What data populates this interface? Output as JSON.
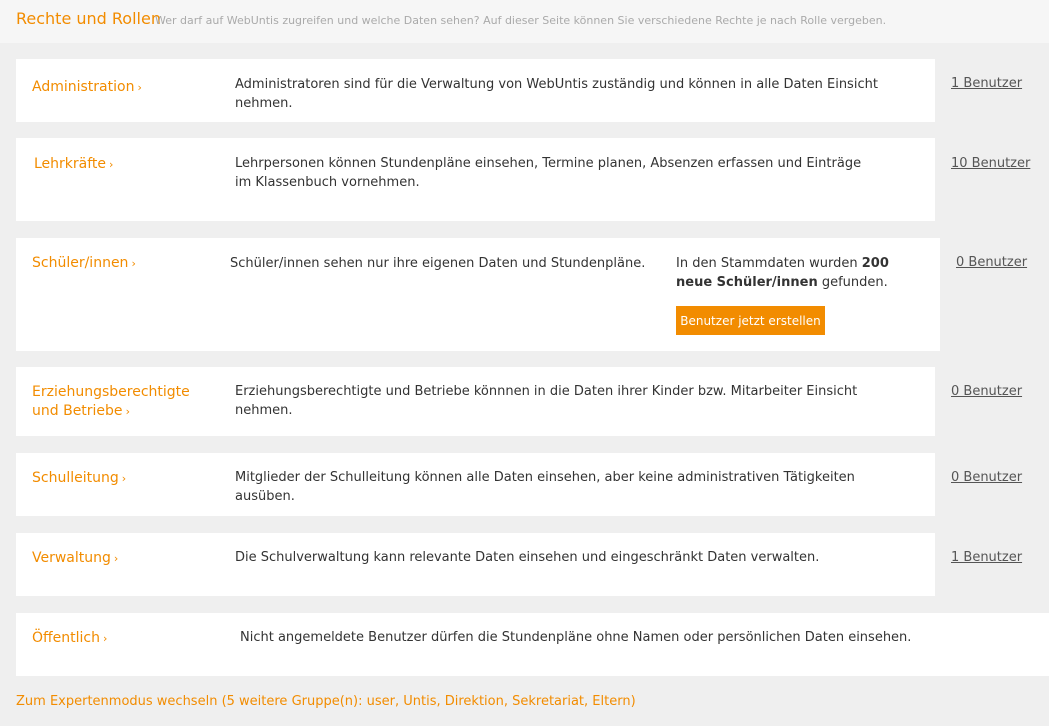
{
  "header": {
    "title": "Rechte und Rollen",
    "subtitle": "Wer darf auf WebUntis zugreifen und welche Daten sehen? Auf dieser Seite können Sie verschiedene Rechte je nach Rolle vergeben."
  },
  "roles": [
    {
      "name": "Administration",
      "description": "Administratoren sind für die Verwaltung von WebUntis zuständig und können in alle Daten Einsicht nehmen.",
      "users": "1 Benutzer"
    },
    {
      "name": "Lehrkräfte",
      "description": "Lehrpersonen können Stundenpläne einsehen, Termine planen, Absenzen erfassen und Einträge im Klassenbuch vornehmen.",
      "users": "10 Benutzer"
    },
    {
      "name": "Schüler/innen",
      "description": "Schüler/innen sehen nur ihre eigenen Daten und Stundenpläne.",
      "users": "0 Benutzer",
      "notice": {
        "prefix": "In den Stammdaten wurden ",
        "bold": "200 neue Schüler/innen",
        "suffix": " gefunden.",
        "button": "Benutzer jetzt erstellen"
      }
    },
    {
      "name_line1": "Erziehungsberechtigte",
      "name_line2": "und Betriebe",
      "description": "Erziehungsberechtigte und Betriebe könnnen in die Daten ihrer Kinder bzw. Mitarbeiter Einsicht nehmen.",
      "users": "0 Benutzer"
    },
    {
      "name": "Schulleitung",
      "description": "Mitglieder der Schulleitung können alle Daten einsehen, aber keine administrativen Tätigkeiten ausüben.",
      "users": "0 Benutzer"
    },
    {
      "name": "Verwaltung",
      "description": "Die Schulverwaltung kann relevante Daten einsehen und eingeschränkt Daten verwalten.",
      "users": "1 Benutzer"
    },
    {
      "name": "Öffentlich",
      "description": "Nicht angemeldete Benutzer dürfen die Stundenpläne ohne Namen oder persönlichen Daten einsehen."
    }
  ],
  "chevron": "›",
  "expert_link": "Zum Expertenmodus wechseln (5 weitere Gruppe(n): user, Untis, Direktion, Sekretariat, Eltern)"
}
